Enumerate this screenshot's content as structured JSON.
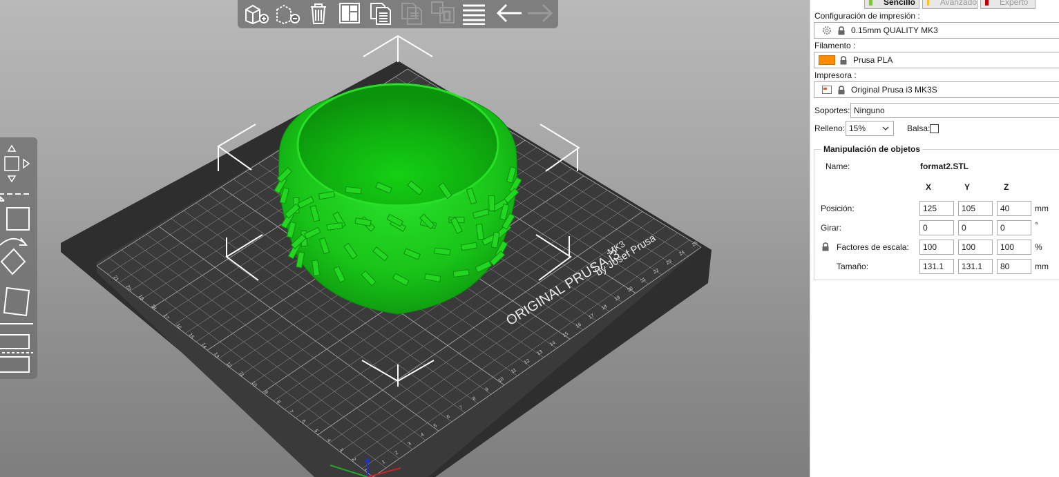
{
  "toolbar": {
    "icons": [
      "add-object-icon",
      "delete-icon",
      "delete-all-icon",
      "arrange-icon",
      "copy-icon",
      "paste-icon",
      "instances-icon",
      "layers-icon",
      "undo-icon",
      "redo-icon"
    ]
  },
  "left_tools": [
    "move-icon",
    "scale-icon",
    "rotate-icon",
    "place-on-face-icon",
    "cut-icon",
    "supports-icon"
  ],
  "bed": {
    "brand": "ORIGINAL PRUSA i3",
    "model": "MK3",
    "byline": "by Josef Prusa",
    "x_ticks": [
      "1",
      "2",
      "3",
      "4",
      "5",
      "6",
      "7",
      "8",
      "9",
      "10",
      "11",
      "12",
      "13",
      "14",
      "15",
      "16",
      "17",
      "18",
      "19",
      "20",
      "21",
      "22",
      "23",
      "24",
      "25"
    ],
    "y_ticks": [
      "1",
      "2",
      "3",
      "4",
      "5",
      "6",
      "7",
      "8",
      "9",
      "10",
      "11",
      "12",
      "13",
      "14",
      "15",
      "16",
      "17",
      "18",
      "19",
      "20",
      "21"
    ]
  },
  "colors": {
    "object": "#22cc22",
    "filament_swatch": "#ff8c00",
    "mode_simple": "#7fc241",
    "mode_advanced": "#f3c624",
    "mode_expert": "#c00000"
  },
  "sidebar": {
    "mode_tabs": [
      {
        "label": "Sencillo",
        "active": true
      },
      {
        "label": "Avanzado",
        "active": false
      },
      {
        "label": "Experto",
        "active": false
      }
    ],
    "print_settings_label": "Configuración de impresión :",
    "print_settings_value": "0.15mm QUALITY MK3",
    "filament_label": "Filamento :",
    "filament_value": "Prusa PLA",
    "printer_label": "Impresora :",
    "printer_value": "Original Prusa i3 MK3S",
    "supports_label": "Soportes:",
    "supports_value": "Ninguno",
    "infill_label": "Relleno:",
    "infill_value": "15%",
    "brim_label": "Balsa:",
    "brim_checked": false
  },
  "manipulation": {
    "title": "Manipulación de objetos",
    "name_label": "Name:",
    "name_value": "format2.STL",
    "axes": [
      "X",
      "Y",
      "Z"
    ],
    "rows": [
      {
        "label": "Posición:",
        "values": [
          "125",
          "105",
          "40"
        ],
        "unit": "mm"
      },
      {
        "label": "Girar:",
        "values": [
          "0",
          "0",
          "0"
        ],
        "unit": "°"
      },
      {
        "label": "Factores de escala:",
        "values": [
          "100",
          "100",
          "100"
        ],
        "unit": "%"
      },
      {
        "label": "Tamaño:",
        "values": [
          "131.1",
          "131.1",
          "80"
        ],
        "unit": "mm"
      }
    ]
  }
}
